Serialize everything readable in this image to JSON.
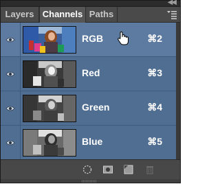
{
  "tabs": [
    {
      "label": "Layers",
      "active": false
    },
    {
      "label": "Channels",
      "active": true
    },
    {
      "label": "Paths",
      "active": false
    }
  ],
  "channels": [
    {
      "label": "RGB",
      "shortcut": "⌘2",
      "thumbnail": "color",
      "visible": true
    },
    {
      "label": "Red",
      "shortcut": "⌘3",
      "thumbnail": "grayscale",
      "visible": true
    },
    {
      "label": "Green",
      "shortcut": "⌘4",
      "thumbnail": "grayscale",
      "visible": true
    },
    {
      "label": "Blue",
      "shortcut": "⌘5",
      "thumbnail": "grayscale",
      "visible": true
    }
  ],
  "bottom_icons": [
    "load-selection-icon",
    "save-selection-icon",
    "new-channel-icon",
    "delete-channel-icon"
  ],
  "colors": {
    "list_background": "#4f6e91",
    "panel_background": "#3f3f3f",
    "text": "#ffffff"
  }
}
